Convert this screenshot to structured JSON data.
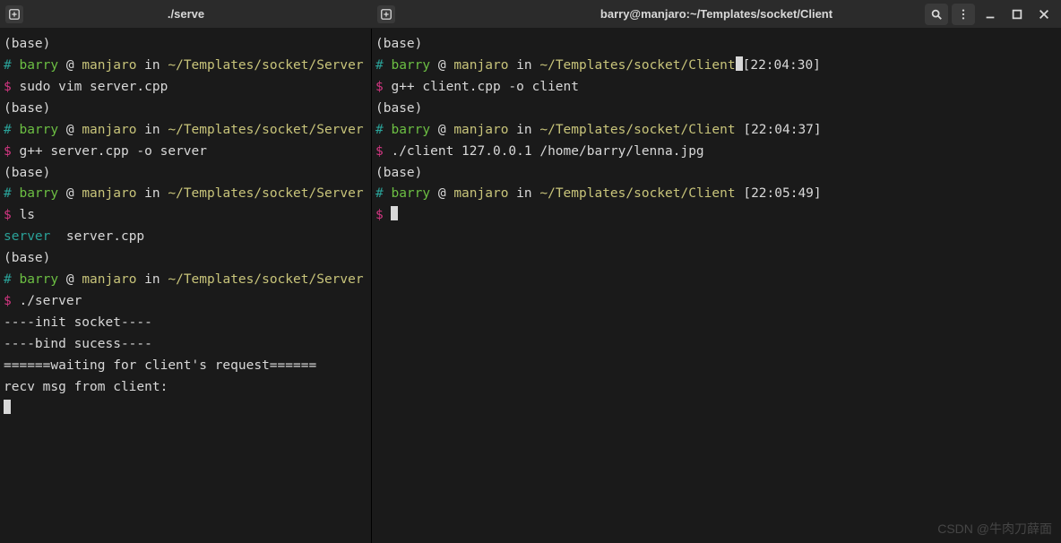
{
  "left": {
    "title": "./serve",
    "lines": [
      {
        "segs": [
          {
            "t": "(base)",
            "c": "c-white"
          }
        ]
      },
      {
        "segs": [
          {
            "t": "# ",
            "c": "c-teal"
          },
          {
            "t": "barry",
            "c": "c-green"
          },
          {
            "t": " @ ",
            "c": "c-white"
          },
          {
            "t": "manjaro",
            "c": "c-hl"
          },
          {
            "t": " in ",
            "c": "c-white"
          },
          {
            "t": "~/Templates/socket/Server",
            "c": "c-hl"
          },
          {
            "t": " [",
            "c": "c-white"
          }
        ]
      },
      {
        "segs": [
          {
            "t": "$ ",
            "c": "c-red"
          },
          {
            "t": "sudo vim server.cpp",
            "c": "c-white"
          }
        ]
      },
      {
        "segs": [
          {
            "t": "(base)",
            "c": "c-white"
          }
        ]
      },
      {
        "segs": [
          {
            "t": "# ",
            "c": "c-teal"
          },
          {
            "t": "barry",
            "c": "c-green"
          },
          {
            "t": " @ ",
            "c": "c-white"
          },
          {
            "t": "manjaro",
            "c": "c-hl"
          },
          {
            "t": " in ",
            "c": "c-white"
          },
          {
            "t": "~/Templates/socket/Server",
            "c": "c-hl"
          },
          {
            "t": " [",
            "c": "c-white"
          }
        ]
      },
      {
        "segs": [
          {
            "t": "$ ",
            "c": "c-red"
          },
          {
            "t": "g++ server.cpp -o server",
            "c": "c-white"
          }
        ]
      },
      {
        "segs": [
          {
            "t": "(base)",
            "c": "c-white"
          }
        ]
      },
      {
        "segs": [
          {
            "t": "# ",
            "c": "c-teal"
          },
          {
            "t": "barry",
            "c": "c-green"
          },
          {
            "t": " @ ",
            "c": "c-white"
          },
          {
            "t": "manjaro",
            "c": "c-hl"
          },
          {
            "t": " in ",
            "c": "c-white"
          },
          {
            "t": "~/Templates/socket/Server",
            "c": "c-hl"
          },
          {
            "t": " [",
            "c": "c-white"
          }
        ]
      },
      {
        "segs": [
          {
            "t": "$ ",
            "c": "c-red"
          },
          {
            "t": "ls",
            "c": "c-white"
          }
        ]
      },
      {
        "segs": [
          {
            "t": "server",
            "c": "c-cyan"
          },
          {
            "t": "  server.cpp",
            "c": "c-white"
          }
        ]
      },
      {
        "segs": [
          {
            "t": "(base)",
            "c": "c-white"
          }
        ]
      },
      {
        "segs": [
          {
            "t": "# ",
            "c": "c-teal"
          },
          {
            "t": "barry",
            "c": "c-green"
          },
          {
            "t": " @ ",
            "c": "c-white"
          },
          {
            "t": "manjaro",
            "c": "c-hl"
          },
          {
            "t": " in ",
            "c": "c-white"
          },
          {
            "t": "~/Templates/socket/Server",
            "c": "c-hl"
          },
          {
            "t": " [",
            "c": "c-white"
          }
        ]
      },
      {
        "segs": [
          {
            "t": "$ ",
            "c": "c-red"
          },
          {
            "t": "./server",
            "c": "c-white"
          }
        ]
      },
      {
        "segs": [
          {
            "t": "----init socket----",
            "c": "c-white"
          }
        ]
      },
      {
        "segs": [
          {
            "t": "----bind sucess----",
            "c": "c-white"
          }
        ]
      },
      {
        "segs": [
          {
            "t": "======waiting for client's request======",
            "c": "c-white"
          }
        ]
      },
      {
        "segs": [
          {
            "t": "recv msg from client:",
            "c": "c-white"
          }
        ]
      },
      {
        "segs": [
          {
            "t": "",
            "c": "c-white",
            "cursor": true
          }
        ]
      }
    ]
  },
  "right": {
    "title": "barry@manjaro:~/Templates/socket/Client",
    "lines": [
      {
        "segs": [
          {
            "t": "(base)",
            "c": "c-white"
          }
        ]
      },
      {
        "segs": [
          {
            "t": "# ",
            "c": "c-teal"
          },
          {
            "t": "barry",
            "c": "c-green"
          },
          {
            "t": " @ ",
            "c": "c-white"
          },
          {
            "t": "manjaro",
            "c": "c-hl"
          },
          {
            "t": " in ",
            "c": "c-white"
          },
          {
            "t": "~/Templates/socket/Client",
            "c": "c-hl"
          },
          {
            "t": "",
            "c": "c-white",
            "cursor": true
          },
          {
            "t": "[22:04:30]",
            "c": "c-white"
          }
        ]
      },
      {
        "segs": [
          {
            "t": "$ ",
            "c": "c-red"
          },
          {
            "t": "g++ client.cpp -o client",
            "c": "c-white"
          }
        ]
      },
      {
        "segs": [
          {
            "t": "(base)",
            "c": "c-white"
          }
        ]
      },
      {
        "segs": [
          {
            "t": "# ",
            "c": "c-teal"
          },
          {
            "t": "barry",
            "c": "c-green"
          },
          {
            "t": " @ ",
            "c": "c-white"
          },
          {
            "t": "manjaro",
            "c": "c-hl"
          },
          {
            "t": " in ",
            "c": "c-white"
          },
          {
            "t": "~/Templates/socket/Client",
            "c": "c-hl"
          },
          {
            "t": " [22:04:37]",
            "c": "c-white"
          }
        ]
      },
      {
        "segs": [
          {
            "t": "$ ",
            "c": "c-red"
          },
          {
            "t": "./client 127.0.0.1 /home/barry/lenna.jpg",
            "c": "c-white"
          }
        ]
      },
      {
        "segs": [
          {
            "t": "(base)",
            "c": "c-white"
          }
        ]
      },
      {
        "segs": [
          {
            "t": "# ",
            "c": "c-teal"
          },
          {
            "t": "barry",
            "c": "c-green"
          },
          {
            "t": " @ ",
            "c": "c-white"
          },
          {
            "t": "manjaro",
            "c": "c-hl"
          },
          {
            "t": " in ",
            "c": "c-white"
          },
          {
            "t": "~/Templates/socket/Client",
            "c": "c-hl"
          },
          {
            "t": " [22:05:49]",
            "c": "c-white"
          }
        ]
      },
      {
        "segs": [
          {
            "t": "$ ",
            "c": "c-red"
          },
          {
            "t": "",
            "c": "c-white",
            "cursor": true
          }
        ]
      }
    ]
  },
  "watermark": "CSDN @牛肉刀薛面"
}
